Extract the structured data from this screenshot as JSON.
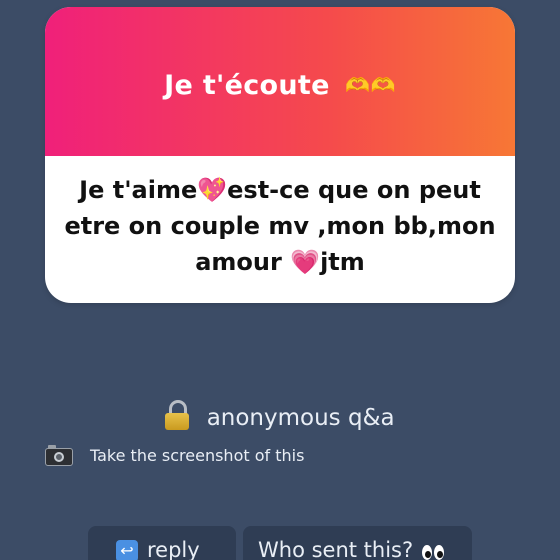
{
  "question_card": {
    "header_title": "Je t'écoute",
    "header_icon": "heart-hands-emoji",
    "question_text": "Je t'aime💖est-ce que on peut etre on couple mv ,mon bb,mon amour 💗jtm"
  },
  "footer": {
    "title": "anonymous q&a",
    "title_icon": "lock-icon",
    "caption": "Take the screenshot of this",
    "caption_icon": "camera-icon"
  },
  "actions": {
    "reply_label": "reply",
    "reply_icon": "reply-arrow-icon",
    "who_sent_label": "Who sent this?",
    "who_sent_icon": "eyes-emoji"
  },
  "colors": {
    "background": "#3c4c66",
    "header_gradient_start": "#f0207a",
    "header_gradient_end": "#f77735",
    "button_background": "#2f3d54"
  }
}
